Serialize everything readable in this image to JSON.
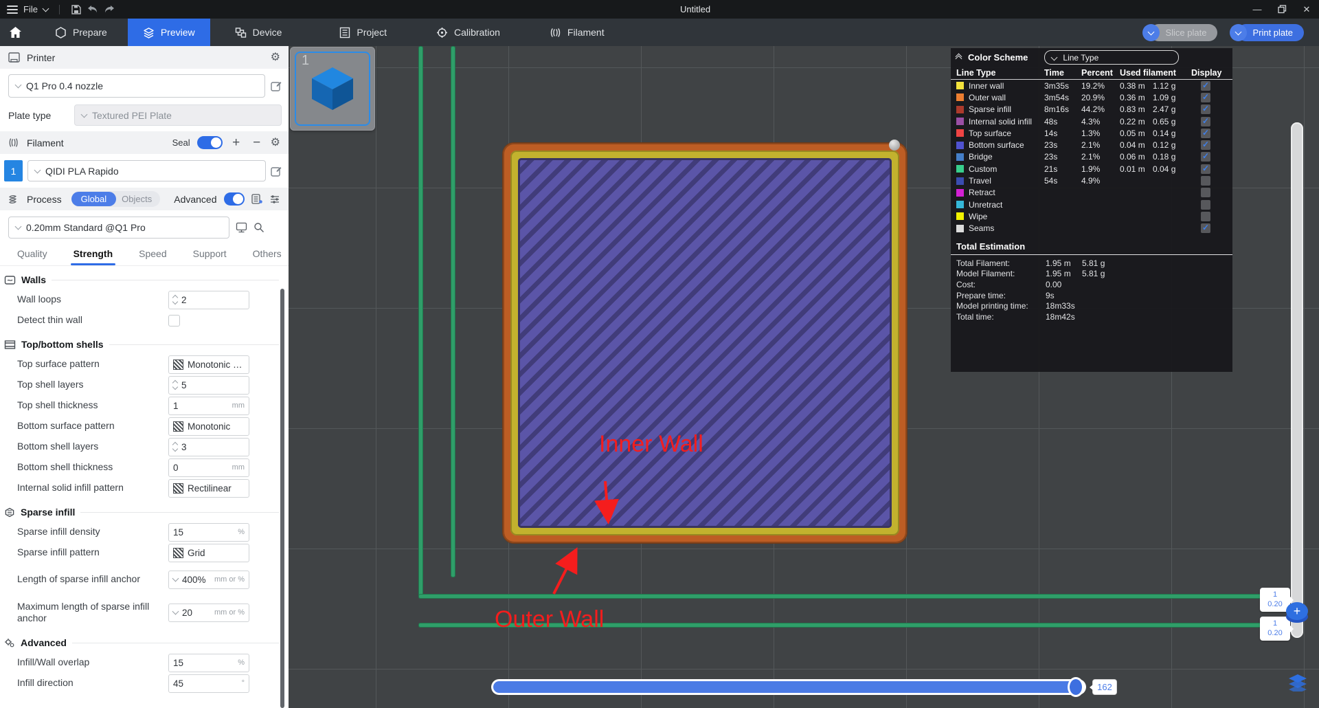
{
  "titlebar": {
    "menu": "File",
    "title": "Untitled"
  },
  "tabbar": {
    "tabs": [
      {
        "label": "Prepare"
      },
      {
        "label": "Preview"
      },
      {
        "label": "Device"
      },
      {
        "label": "Project"
      },
      {
        "label": "Calibration"
      },
      {
        "label": "Filament"
      }
    ],
    "slice_button": "Slice plate",
    "print_button": "Print plate"
  },
  "printer": {
    "header": "Printer",
    "model": "Q1 Pro 0.4 nozzle",
    "plate_type_label": "Plate type",
    "plate_type_value": "Textured PEI Plate"
  },
  "filament": {
    "header": "Filament",
    "seal_label": "Seal",
    "slot": "1",
    "name": "QIDI PLA Rapido"
  },
  "process": {
    "header": "Process",
    "seg_global": "Global",
    "seg_objects": "Objects",
    "advanced_label": "Advanced",
    "preset": "0.20mm Standard @Q1 Pro",
    "tabs": [
      "Quality",
      "Strength",
      "Speed",
      "Support",
      "Others"
    ]
  },
  "settings": {
    "walls_title": "Walls",
    "wall_loops_label": "Wall loops",
    "wall_loops_value": "2",
    "detect_thin_label": "Detect thin wall",
    "shells_title": "Top/bottom shells",
    "top_surface_pattern_label": "Top surface pattern",
    "top_surface_pattern_value": "Monotonic …",
    "top_shell_layers_label": "Top shell layers",
    "top_shell_layers_value": "5",
    "top_shell_thickness_label": "Top shell thickness",
    "top_shell_thickness_value": "1",
    "top_shell_thickness_unit": "mm",
    "bottom_surface_pattern_label": "Bottom surface pattern",
    "bottom_surface_pattern_value": "Monotonic",
    "bottom_shell_layers_label": "Bottom shell layers",
    "bottom_shell_layers_value": "3",
    "bottom_shell_thickness_label": "Bottom shell thickness",
    "bottom_shell_thickness_value": "0",
    "bottom_shell_thickness_unit": "mm",
    "internal_pattern_label": "Internal solid infill pattern",
    "internal_pattern_value": "Rectilinear",
    "sparse_title": "Sparse infill",
    "density_label": "Sparse infill density",
    "density_value": "15",
    "density_unit": "%",
    "sparse_pattern_label": "Sparse infill pattern",
    "sparse_pattern_value": "Grid",
    "anchor_label": "Length of sparse infill anchor",
    "anchor_value": "400%",
    "anchor_unit": "mm or %",
    "max_anchor_label": "Maximum length of sparse infill anchor",
    "max_anchor_value": "20",
    "max_anchor_unit": "mm or %",
    "advanced_title": "Advanced",
    "overlap_label": "Infill/Wall overlap",
    "overlap_value": "15",
    "overlap_unit": "%",
    "direction_label": "Infill direction",
    "direction_value": "45",
    "direction_unit": "°"
  },
  "legend": {
    "title": "Color Scheme",
    "view_mode": "Line Type",
    "columns": [
      "Line Type",
      "Time",
      "Percent",
      "Used filament",
      "Display"
    ],
    "rows": [
      {
        "name": "Inner wall",
        "color": "#f3e13c",
        "time": "3m35s",
        "percent": "19.2%",
        "length": "0.38 m",
        "weight": "1.12 g",
        "display": true
      },
      {
        "name": "Outer wall",
        "color": "#ed7e31",
        "time": "3m54s",
        "percent": "20.9%",
        "length": "0.36 m",
        "weight": "1.09 g",
        "display": true
      },
      {
        "name": "Sparse infill",
        "color": "#ac3a2c",
        "time": "8m16s",
        "percent": "44.2%",
        "length": "0.83 m",
        "weight": "2.47 g",
        "display": true
      },
      {
        "name": "Internal solid infill",
        "color": "#9a4fa5",
        "time": "48s",
        "percent": "4.3%",
        "length": "0.22 m",
        "weight": "0.65 g",
        "display": true
      },
      {
        "name": "Top surface",
        "color": "#ef4444",
        "time": "14s",
        "percent": "1.3%",
        "length": "0.05 m",
        "weight": "0.14 g",
        "display": true
      },
      {
        "name": "Bottom surface",
        "color": "#5052d0",
        "time": "23s",
        "percent": "2.1%",
        "length": "0.04 m",
        "weight": "0.12 g",
        "display": true
      },
      {
        "name": "Bridge",
        "color": "#447ec8",
        "time": "23s",
        "percent": "2.1%",
        "length": "0.06 m",
        "weight": "0.18 g",
        "display": true
      },
      {
        "name": "Custom",
        "color": "#38ce8c",
        "time": "21s",
        "percent": "1.9%",
        "length": "0.01 m",
        "weight": "0.04 g",
        "display": true
      },
      {
        "name": "Travel",
        "color": "#3a4db0",
        "time": "54s",
        "percent": "4.9%",
        "length": "",
        "weight": "",
        "display": false
      },
      {
        "name": "Retract",
        "color": "#d321d3",
        "time": "",
        "percent": "",
        "length": "",
        "weight": "",
        "display": false
      },
      {
        "name": "Unretract",
        "color": "#35b7d8",
        "time": "",
        "percent": "",
        "length": "",
        "weight": "",
        "display": false
      },
      {
        "name": "Wipe",
        "color": "#f2f200",
        "time": "",
        "percent": "",
        "length": "",
        "weight": "",
        "display": false
      },
      {
        "name": "Seams",
        "color": "#dcdcdc",
        "time": "",
        "percent": "",
        "length": "",
        "weight": "",
        "display": true
      }
    ],
    "totals": {
      "title": "Total Estimation",
      "rows": [
        {
          "label": "Total Filament:",
          "v1": "1.95 m",
          "v2": "5.81 g"
        },
        {
          "label": "Model Filament:",
          "v1": "1.95 m",
          "v2": "5.81 g"
        },
        {
          "label": "Cost:",
          "v1": "0.00",
          "v2": ""
        },
        {
          "label": "Prepare time:",
          "v1": "9s",
          "v2": ""
        },
        {
          "label": "Model printing time:",
          "v1": "18m33s",
          "v2": ""
        },
        {
          "label": "Total time:",
          "v1": "18m42s",
          "v2": ""
        }
      ]
    }
  },
  "viewport": {
    "plate_number": "1",
    "annotation_inner": "Inner Wall",
    "annotation_outer": "Outer Wall",
    "layer_badge_top": {
      "line1": "1",
      "line2": "0.20"
    },
    "layer_badge_bottom": {
      "line1": "1",
      "line2": "0.20"
    },
    "step_value": "162"
  }
}
